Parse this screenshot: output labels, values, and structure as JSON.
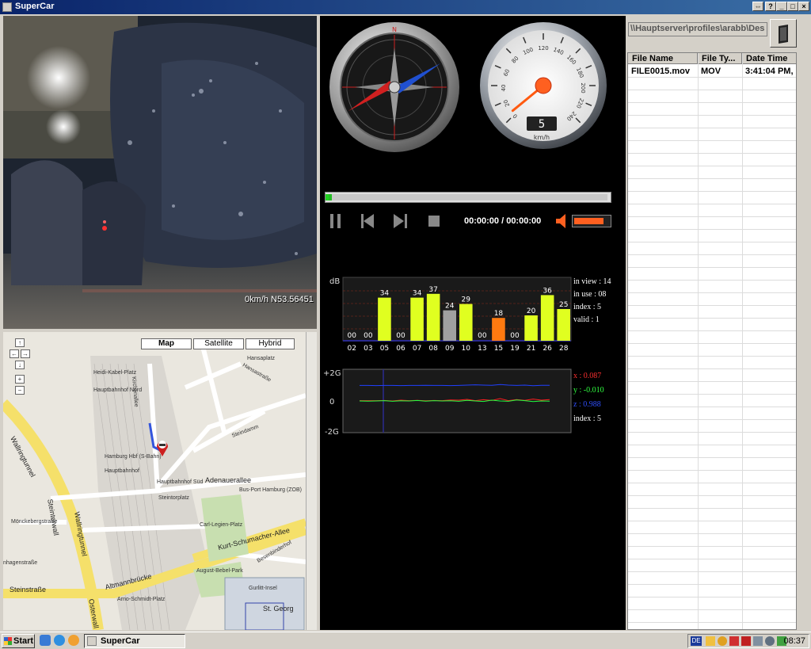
{
  "window": {
    "title": "SuperCar"
  },
  "video": {
    "overlay_text": "0km/h N53.56451"
  },
  "map": {
    "types": [
      "Map",
      "Satellite",
      "Hybrid"
    ],
    "labels": {
      "heidi": "Heidi-Kabel-Platz",
      "hbf_nord": "Hauptbahnhof\nNord",
      "kirchenallee": "Kirchenallee",
      "hansaplatz": "Hansaplatz",
      "hansastr": "Hansastraße",
      "steindamm": "Steindamm",
      "hbf_s": "Hamburg\nHbf (S-Bahn)",
      "hbf": "Hauptbahnhof",
      "hbf_sued": "Hauptbahnhof\nSüd",
      "adenauer": "Adenauerallee",
      "steintorplatz": "Steintorplatz",
      "bus_port": "Bus-Port\nHamburg (ZOB)",
      "moenckeberg": "Mönckebergstraße",
      "carl_legien": "Carl-Legien-Platz",
      "kurt": "Kurt-Schumacher-Allee",
      "besenbinder": "Besenbinderhof",
      "wallringtunnel": "Wallringtunnel",
      "steintorwall": "Steintorwall",
      "wallringtunnel2": "Wallringtunnel",
      "hagen": "nhagenstraße",
      "steinstr": "Steinstraße",
      "altmann": "Altmannbrücke",
      "bebel": "August-Bebel-Park",
      "arno": "Arno-Schmidt-Platz",
      "gurlitt": "Gurlitt-Insel",
      "st_georg": "St. Georg",
      "osterwall": "Osterwall"
    }
  },
  "compass": {
    "heading_deg": 64
  },
  "speedometer": {
    "value": "5",
    "unit": "km/h",
    "ticks": [
      "0",
      "20",
      "40",
      "60",
      "80",
      "100",
      "120",
      "140",
      "160",
      "180",
      "200",
      "220",
      "240"
    ]
  },
  "player": {
    "time": "00:00:00 / 00:00:00",
    "progress": 0.01,
    "volume": 0.85
  },
  "signal_chart": {
    "unit": "dB",
    "info": [
      "in view : 14",
      "in use : 08",
      "index : 5",
      "valid : 1"
    ]
  },
  "accel_chart": {
    "labels_y": [
      "+2G",
      "0",
      "-2G"
    ],
    "x_label": "x : 0.087",
    "y_label": "y : -0.010",
    "z_label": "z : 0.988",
    "index_label": "index : 5"
  },
  "files": {
    "path": "\\\\Hauptserver\\profiles\\arabb\\Des",
    "columns": [
      "File Name",
      "File Ty...",
      "Date Time"
    ],
    "rows": [
      [
        "FILE0015.mov",
        "MOV",
        "3:41:04 PM,"
      ]
    ]
  },
  "taskbar": {
    "start": "Start",
    "task": "SuperCar",
    "clock": "08:37",
    "lang": "DE"
  },
  "chart_data": [
    {
      "type": "bar",
      "ylabel": "dB",
      "categories": [
        "02",
        "03",
        "05",
        "06",
        "07",
        "08",
        "09",
        "10",
        "13",
        "15",
        "19",
        "21",
        "26",
        "28"
      ],
      "values": [
        0,
        0,
        34,
        0,
        34,
        37,
        24,
        29,
        0,
        18,
        0,
        20,
        36,
        25
      ],
      "value_labels": [
        "00",
        "00",
        "34",
        "00",
        "34",
        "37",
        "24",
        "29",
        "00",
        "18",
        "00",
        "20",
        "36",
        "25"
      ],
      "colors": [
        "#e0ff20",
        "#e0ff20",
        "#e0ff20",
        "#e0ff20",
        "#e0ff20",
        "#e0ff20",
        "#a0a0a0",
        "#e0ff20",
        "#e0ff20",
        "#ff7a10",
        "#e0ff20",
        "#e0ff20",
        "#e0ff20",
        "#e0ff20"
      ],
      "ylim": [
        0,
        50
      ]
    },
    {
      "type": "line",
      "ylim": [
        -2,
        2
      ],
      "series": [
        {
          "name": "x",
          "color": "#ff2020",
          "values": [
            0.02,
            0.02,
            0.02,
            0.03,
            0.0,
            0.05,
            0.02,
            0.04,
            0.01,
            0.03,
            0.02,
            0.06,
            0.05,
            0.1,
            0.02,
            0.08,
            0.03,
            0.15,
            0.02,
            0.09,
            0.04,
            0.12,
            0.05,
            0.087
          ]
        },
        {
          "name": "y",
          "color": "#20ff40",
          "values": [
            0.0,
            -0.01,
            0.0,
            0.02,
            -0.02,
            0.01,
            0.0,
            0.03,
            -0.01,
            0.02,
            0.0,
            0.01,
            -0.02,
            0.04,
            0.0,
            -0.03,
            0.05,
            0.0,
            -0.02,
            0.06,
            0.02,
            -0.04,
            0.0,
            -0.01
          ]
        },
        {
          "name": "z",
          "color": "#2040ff",
          "values": [
            0.98,
            0.98,
            0.97,
            0.98,
            0.98,
            0.97,
            0.98,
            0.98,
            0.99,
            0.98,
            0.98,
            0.97,
            0.98,
            1.0,
            1.02,
            1.0,
            0.99,
            1.04,
            1.0,
            0.98,
            1.0,
            0.96,
            0.99,
            0.988
          ]
        }
      ]
    }
  ]
}
